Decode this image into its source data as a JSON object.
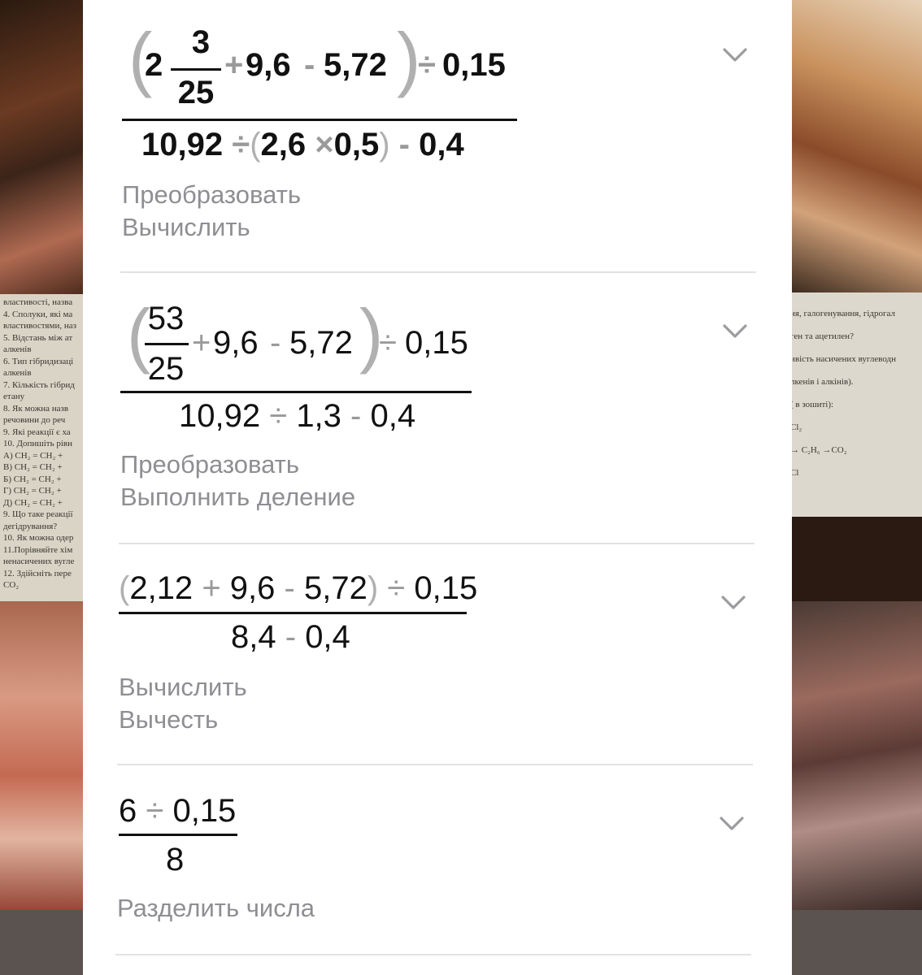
{
  "steps": [
    {
      "numerator": {
        "whole": "2",
        "frac_num": "3",
        "frac_den": "25",
        "terms": [
          "9,6",
          "5,72"
        ],
        "divisor": "0,15"
      },
      "denominator": {
        "a": "10,92",
        "b": "2,6",
        "c": "0,5",
        "d": "0,4"
      },
      "actions": [
        "Преобразовать",
        "Вычислить"
      ]
    },
    {
      "numerator": {
        "frac_num": "53",
        "frac_den": "25",
        "terms": [
          "9,6",
          "5,72"
        ],
        "divisor": "0,15"
      },
      "denominator": {
        "a": "10,92",
        "b": "1,3",
        "c": "0,4"
      },
      "actions": [
        "Преобразовать",
        "Выполнить деление"
      ]
    },
    {
      "numerator": {
        "a": "2,12",
        "b": "9,6",
        "c": "5,72",
        "divisor": "0,15"
      },
      "denominator": {
        "a": "8,4",
        "b": "0,4"
      },
      "actions": [
        "Вычислить",
        "Вычесть"
      ]
    },
    {
      "numerator": {
        "a": "6",
        "divisor": "0,15"
      },
      "denominator": {
        "a": "8"
      },
      "actions": [
        "Разделить числа"
      ]
    }
  ],
  "symbols": {
    "plus": "+",
    "minus": "-",
    "divide": "÷",
    "times": "×",
    "lparen": "(",
    "rparen": ")"
  },
  "icons": {
    "expand": "chevron-down-icon"
  },
  "background_doc": {
    "left_lines": [
      "властивості, назва",
      "4. Сполуки, які ма",
      "властивостями, наз",
      "5. Відстань між ат",
      "алкенів",
      "6. Тип гібридизаці",
      "алкенів",
      "7. Кількість гібрид",
      "етану",
      "8. Як можна назв",
      "речовини до реч",
      "9. Які реакції є ха",
      "10. Допишіть рівн",
      "А) CH₂ = CH₂ +",
      "В) CH₂ = CH₂ +",
      "Б) CH₂ = CH₂ +",
      "Г) CH₂ = CH₂ +",
      "Д) CH₂ = CH₂ +",
      "9. Що таке реакції",
      "дегідрування?",
      "10. Як можна одер",
      "11.Порівняйте хім",
      "ненасичених вугле",
      "12. Здійсніть пере",
      "CO₂"
    ],
    "right_lines": [
      "ня, галогенування, гідрогал",
      "ген та ацетилен?",
      "ивість насичених вуглеводн",
      "лкенів і алкінів).",
      "( в зошиті):",
      "Cl₂",
      "→ C₂H₆ →CO₂",
      "Cl"
    ]
  }
}
